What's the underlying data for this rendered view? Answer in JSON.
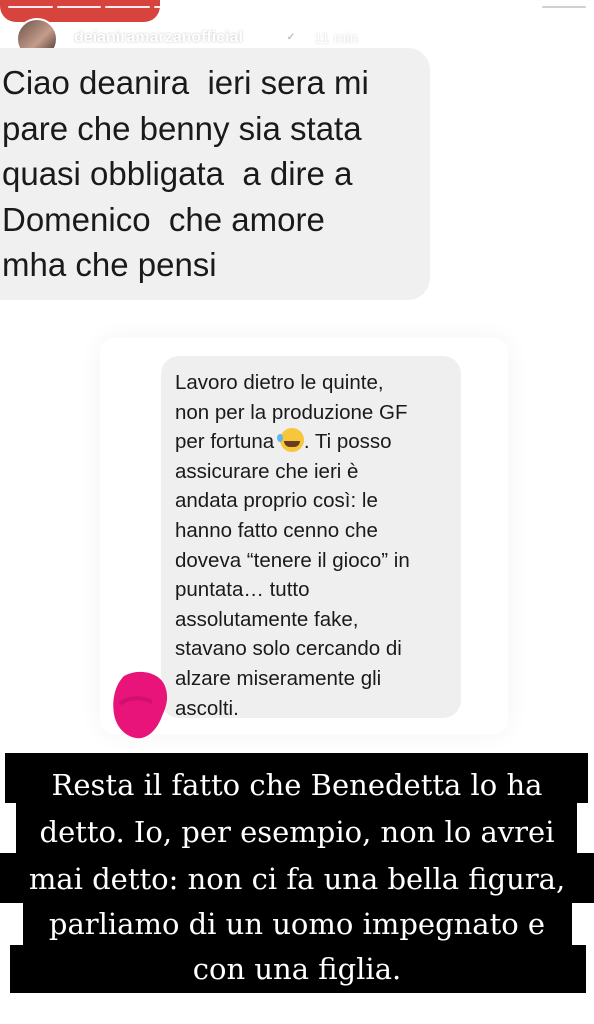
{
  "story": {
    "username": "deianiramarzanofficial",
    "verified_icon": "verified-badge-icon",
    "time": "11 min",
    "more_label": "•••",
    "close_icon": "close-icon",
    "progress_segments": 12,
    "progress_done": 11
  },
  "question_bubble": {
    "lines": [
      "Ciao deanira  ieri sera mi",
      "pare che benny sia stata",
      "quasi obbligata  a dire a",
      "Domenico  che amore",
      "mha che pensi"
    ]
  },
  "reply_bubble": {
    "line1": "Lavoro dietro le quinte,",
    "line2": "non per la produzione GF",
    "line3_before": "per fortuna ",
    "line3_emoji": "rolling-on-floor-laughing-emoji",
    "line3_after": ". Ti posso",
    "line4": "assicurare che ieri è",
    "line5": "andata proprio così: le",
    "line6": "hanno fatto cenno che",
    "line7": "doveva “tenere il gioco” in",
    "line8": "puntata… tutto",
    "line9": "assolutamente fake,",
    "line10": "stavano solo cercando di",
    "line11": "alzare miseramente gli",
    "line12": "ascolti."
  },
  "caption": {
    "lines": [
      "Resta il fatto che Benedetta lo ha",
      "detto. Io, per esempio, non lo avrei",
      "mai detto: non ci fa una bella figura,",
      "parliamo di un uomo impegnato e",
      "con una figlia."
    ]
  },
  "colors": {
    "caption_background": "#000000",
    "bubble_background": "#efefef",
    "scribble": "#e8147a",
    "top_tab": "#d7443e"
  }
}
